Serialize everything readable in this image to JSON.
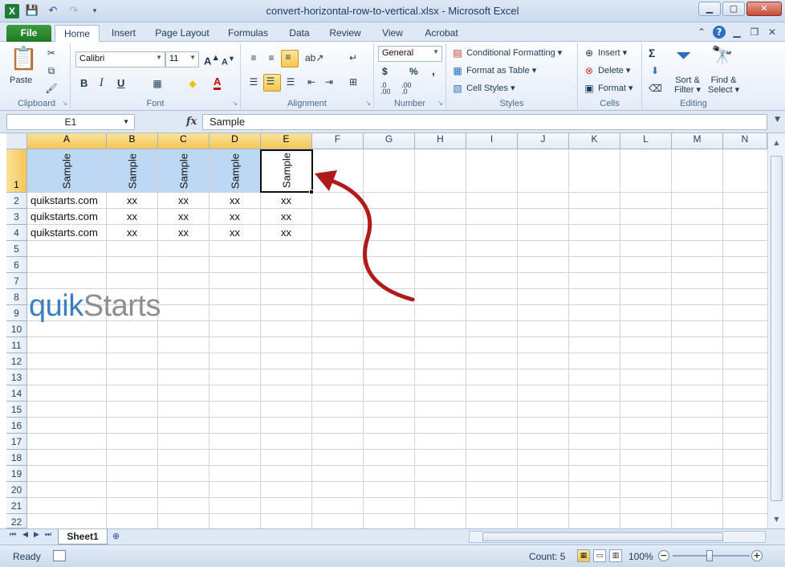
{
  "window": {
    "title": "convert-horizontal-row-to-vertical.xlsx - Microsoft Excel",
    "app_icon": "X"
  },
  "tabs": [
    "File",
    "Home",
    "Insert",
    "Page Layout",
    "Formulas",
    "Data",
    "Review",
    "View",
    "Acrobat"
  ],
  "ribbon": {
    "clipboard": {
      "paste": "Paste",
      "label": "Clipboard"
    },
    "font": {
      "name": "Calibri",
      "size": "11",
      "bold": "B",
      "italic": "I",
      "underline": "U",
      "label": "Font"
    },
    "alignment": {
      "label": "Alignment"
    },
    "number": {
      "format": "General",
      "currency": "$",
      "percent": "%",
      "comma": ",",
      "inc": ".0 .00",
      "dec": ".00 .0",
      "label": "Number"
    },
    "styles": {
      "conditional": "Conditional Formatting",
      "table": "Format as Table",
      "cell_styles": "Cell Styles",
      "label": "Styles"
    },
    "cells": {
      "insert": "Insert",
      "delete": "Delete",
      "format": "Format",
      "label": "Cells"
    },
    "editing": {
      "sigma": "Σ",
      "sort1": "Sort &",
      "sort2": "Filter",
      "find1": "Find &",
      "find2": "Select",
      "label": "Editing"
    }
  },
  "formula_bar": {
    "name_box": "E1",
    "fx": "fx",
    "value": "Sample"
  },
  "columns": [
    "A",
    "B",
    "C",
    "D",
    "E",
    "F",
    "G",
    "H",
    "I",
    "J",
    "K",
    "L",
    "M",
    "N"
  ],
  "rows": [
    "1",
    "2",
    "3",
    "4",
    "5",
    "6",
    "7",
    "8",
    "9",
    "10",
    "11",
    "12",
    "13",
    "14",
    "15",
    "16",
    "17",
    "18",
    "19",
    "20",
    "21",
    "22"
  ],
  "cells": {
    "header": [
      "Sample",
      "Sample",
      "Sample",
      "Sample",
      "Sample"
    ],
    "row2": [
      "quikstarts.com",
      "xx",
      "xx",
      "xx",
      "xx"
    ],
    "row3": [
      "quikstarts.com",
      "xx",
      "xx",
      "xx",
      "xx"
    ],
    "row4": [
      "quikstarts.com",
      "xx",
      "xx",
      "xx",
      "xx"
    ]
  },
  "logo": {
    "part1": "quik",
    "part2": "Starts"
  },
  "sheet": {
    "name": "Sheet1"
  },
  "status": {
    "ready": "Ready",
    "count": "Count: 5",
    "zoom": "100%"
  },
  "colors": {
    "selection": "#bcd8f5",
    "header_selected": "#f3c656",
    "arrow": "#b01a1a",
    "logo_blue": "#3b7fc1",
    "logo_gray": "#8a8f94"
  }
}
